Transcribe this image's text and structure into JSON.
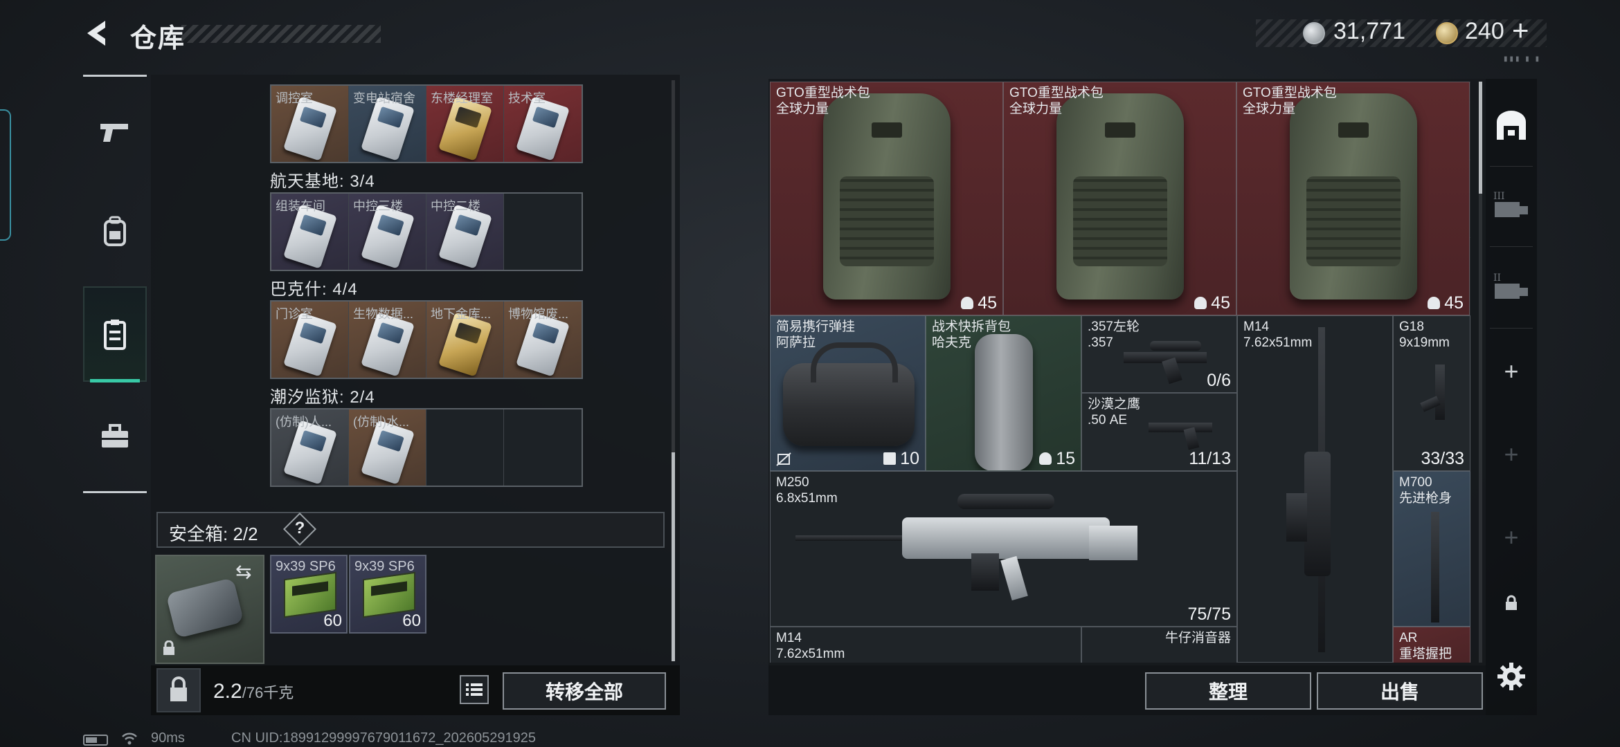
{
  "header": {
    "title": "仓库",
    "silver_amount": "31,771",
    "gold_amount": "240",
    "add_symbol": "+",
    "deco_text": "▮▮▮ ▮ ▮"
  },
  "colors": {
    "accent": "#38c9a6",
    "rare_red": "#5c2a2d",
    "rare_blue": "#3b4b5c",
    "rare_green": "#2f4439",
    "gold_slot": "#6a4f3c"
  },
  "left_nav": [
    {
      "icon": "pistol-icon"
    },
    {
      "icon": "backpack-icon"
    },
    {
      "icon": "keycard-case-icon",
      "active": true
    },
    {
      "icon": "toolbox-icon"
    }
  ],
  "key_rows": [
    {
      "title": "",
      "slots": [
        "调控室",
        "变电站宿舍",
        "东楼经理室",
        "技术室"
      ]
    },
    {
      "title": "航天基地: 3/4",
      "slots": [
        "组装车间",
        "中控三楼",
        "中控二楼",
        ""
      ]
    },
    {
      "title": "巴克什: 4/4",
      "slots": [
        "门诊室",
        "生物数据...",
        "地下金库...",
        "博物馆废..."
      ]
    },
    {
      "title": "潮汐监狱: 2/4",
      "slots": [
        "(仿制)人...",
        "(仿制)水...",
        "",
        ""
      ]
    }
  ],
  "safebox": {
    "label": "安全箱: 2/2",
    "help": "?",
    "swap_symbol": "⇆",
    "ammo": [
      {
        "name": "9x39 SP6",
        "count": "60"
      },
      {
        "name": "9x39 SP6",
        "count": "60"
      }
    ]
  },
  "footer_left": {
    "weight_current": "2.2",
    "weight_max": "/76千克",
    "transfer_all": "转移全部"
  },
  "stash": {
    "backpacks": [
      {
        "name": "GTO重型战术包",
        "sub": "全球力量",
        "count": "45"
      },
      {
        "name": "GTO重型战术包",
        "sub": "全球力量",
        "count": "45"
      },
      {
        "name": "GTO重型战术包",
        "sub": "全球力量",
        "count": "45"
      }
    ],
    "chest_rig": {
      "name": "简易携行弹挂",
      "sub": "阿萨拉",
      "count": "10"
    },
    "tactical_bag": {
      "name": "战术快拆背包",
      "sub": "哈夫克",
      "count": "15"
    },
    "revolver": {
      "name": ".357左轮",
      "sub": ".357",
      "count": "0/6"
    },
    "deagle": {
      "name": "沙漠之鹰",
      "sub": ".50 AE",
      "count": "11/13"
    },
    "m14_top": {
      "name": "M14",
      "sub": "7.62x51mm"
    },
    "g18": {
      "name": "G18",
      "sub": "9x19mm",
      "count": "33/33"
    },
    "m250": {
      "name": "M250",
      "sub": "6.8x51mm",
      "count": "75/75"
    },
    "m700": {
      "name": "M700",
      "sub": "先进枪身"
    },
    "m14_bottom": {
      "name": "M14",
      "sub": "7.62x51mm"
    },
    "suppressor": {
      "name": "牛仔消音器"
    },
    "ar_grip": {
      "name": "AR",
      "sub": "重塔握把"
    }
  },
  "stash_buttons": {
    "sort": "整理",
    "sell": "出售"
  },
  "right_sidebar": {
    "plus": "+"
  },
  "status": {
    "ping": "90ms",
    "uid": "CN UID:18991299997679011672_202605291925"
  }
}
